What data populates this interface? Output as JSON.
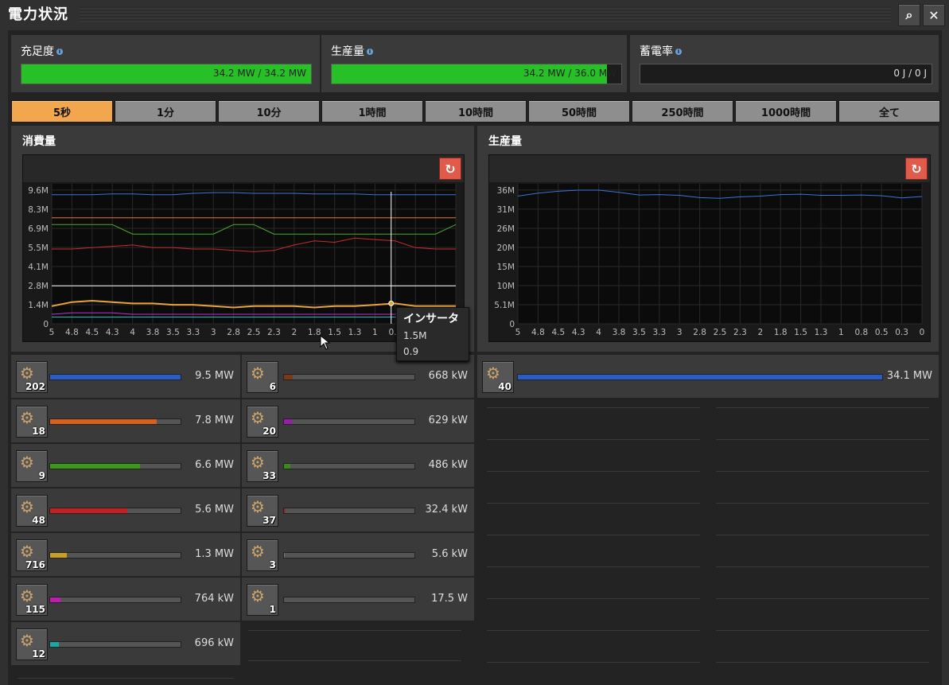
{
  "window": {
    "title": "電力状況"
  },
  "stats": {
    "satisfaction": {
      "label": "充足度",
      "value": "34.2 MW / 34.2 MW",
      "fill": 1.0
    },
    "production": {
      "label": "生産量",
      "value": "34.2 MW / 36.0 MW",
      "fill": 0.95
    },
    "accumulator": {
      "label": "蓄電率",
      "value": "0 J / 0 J",
      "fill": 0
    }
  },
  "tabs": [
    {
      "label": "5秒",
      "active": true
    },
    {
      "label": "1分"
    },
    {
      "label": "10分"
    },
    {
      "label": "1時間"
    },
    {
      "label": "10時間"
    },
    {
      "label": "50時間"
    },
    {
      "label": "250時間"
    },
    {
      "label": "1000時間"
    },
    {
      "label": "全て"
    }
  ],
  "consumption": {
    "label": "消費量",
    "chart_data": {
      "type": "line",
      "title": "消費量",
      "x_ticks": [
        "5",
        "4.8",
        "4.5",
        "4.3",
        "4",
        "3.8",
        "3.5",
        "3.3",
        "3",
        "2.8",
        "2.5",
        "2.3",
        "2",
        "1.8",
        "1.5",
        "1.3",
        "1",
        "0.8",
        "0.5",
        "0.3",
        "0"
      ],
      "y_ticks": [
        "0",
        "1.4M",
        "2.8M",
        "4.1M",
        "5.5M",
        "6.9M",
        "8.3M",
        "9.6M"
      ],
      "ylim": [
        0,
        10300000
      ],
      "series": [
        {
          "color": "#3c73d6",
          "values": [
            9500000,
            9500000,
            9500000,
            9550000,
            9550000,
            9500000,
            9500000,
            9600000,
            9650000,
            9650000,
            9600000,
            9600000,
            9600000,
            9550000,
            9550000,
            9550000,
            9500000,
            9500000,
            9500000,
            9500000,
            9500000
          ]
        },
        {
          "color": "#e67a32",
          "values": [
            7800000,
            7800000,
            7800000,
            7800000,
            7800000,
            7800000,
            7800000,
            7800000,
            7800000,
            7800000,
            7800000,
            7800000,
            7800000,
            7800000,
            7800000,
            7800000,
            7800000,
            7800000,
            7800000,
            7800000,
            7800000
          ]
        },
        {
          "color": "#4aaa2a",
          "values": [
            7300000,
            7300000,
            7300000,
            7300000,
            6600000,
            6600000,
            6600000,
            6600000,
            6600000,
            7300000,
            7300000,
            6600000,
            6600000,
            6600000,
            6600000,
            6600000,
            6600000,
            6600000,
            6600000,
            6600000,
            7300000
          ]
        },
        {
          "color": "#c62d2d",
          "values": [
            5500000,
            5500000,
            5600000,
            5700000,
            5800000,
            5600000,
            5600000,
            5500000,
            5500000,
            5400000,
            5300000,
            5400000,
            5800000,
            6100000,
            6000000,
            6300000,
            6200000,
            6100000,
            5600000,
            5500000,
            5500000
          ]
        },
        {
          "color": "#e8a33a",
          "values": [
            1300000,
            1600000,
            1700000,
            1600000,
            1500000,
            1500000,
            1400000,
            1400000,
            1300000,
            1200000,
            1300000,
            1300000,
            1300000,
            1200000,
            1300000,
            1300000,
            1400000,
            1500000,
            1300000,
            1300000,
            1300000
          ]
        },
        {
          "color": "#c22ed6",
          "values": [
            700000,
            800000,
            800000,
            800000,
            700000,
            700000,
            700000,
            700000,
            700000,
            700000,
            700000,
            700000,
            700000,
            700000,
            700000,
            700000,
            700000,
            700000,
            700000,
            700000,
            700000
          ]
        },
        {
          "color": "#2ab8b8",
          "values": [
            500000,
            500000,
            500000,
            500000,
            500000,
            500000,
            500000,
            500000,
            500000,
            500000,
            500000,
            500000,
            500000,
            500000,
            500000,
            500000,
            500000,
            500000,
            500000,
            500000,
            500000
          ]
        },
        {
          "color": "#ffffff",
          "values": [
            2800000,
            2800000,
            2800000,
            2800000,
            2800000,
            2800000,
            2800000,
            2800000,
            2800000,
            2800000,
            2800000,
            2800000,
            2800000,
            2800000,
            2800000,
            2800000,
            2800000,
            2800000,
            2800000,
            2800000,
            2800000
          ]
        }
      ],
      "cursor_x": "0.9"
    },
    "tooltip": {
      "title": "インサータ",
      "value": "1.5M",
      "time": "0.9"
    }
  },
  "production_chart": {
    "label": "生産量",
    "chart_data": {
      "type": "line",
      "title": "生産量",
      "x_ticks": [
        "5",
        "4.8",
        "4.5",
        "4.3",
        "4",
        "3.8",
        "3.5",
        "3.3",
        "3",
        "2.8",
        "2.5",
        "2.3",
        "2",
        "1.8",
        "1.5",
        "1.3",
        "1",
        "0.8",
        "0.5",
        "0.3",
        "0"
      ],
      "y_ticks": [
        "0",
        "5.1M",
        "10M",
        "15M",
        "20M",
        "26M",
        "31M",
        "36M"
      ],
      "ylim": [
        0,
        37500000
      ],
      "series": [
        {
          "color": "#3c73d6",
          "values": [
            34200000,
            35000000,
            35500000,
            35800000,
            35800000,
            35200000,
            34500000,
            34600000,
            34400000,
            33800000,
            33600000,
            34000000,
            34200000,
            34600000,
            34700000,
            34400000,
            34400000,
            34500000,
            34300000,
            33700000,
            34100000
          ]
        }
      ]
    }
  },
  "consumers_left": [
    {
      "count": "202",
      "value": "9.5 MW",
      "fill": 1.0,
      "color": "#2a5cc8",
      "icon": "radar-icon"
    },
    {
      "count": "18",
      "value": "7.8 MW",
      "fill": 0.82,
      "color": "#d9601a",
      "icon": "assembling-machine-icon"
    },
    {
      "count": "9",
      "value": "6.6 MW",
      "fill": 0.69,
      "color": "#3a9a1a",
      "icon": "pumpjack-icon"
    },
    {
      "count": "48",
      "value": "5.6 MW",
      "fill": 0.59,
      "color": "#c42020",
      "icon": "electric-mining-drill-icon"
    },
    {
      "count": "716",
      "value": "1.3 MW",
      "fill": 0.13,
      "color": "#c8a020",
      "icon": "inserter-icon"
    },
    {
      "count": "115",
      "value": "764 kW",
      "fill": 0.08,
      "color": "#c21ab2",
      "icon": "fast-inserter-icon"
    },
    {
      "count": "12",
      "value": "696 kW",
      "fill": 0.07,
      "color": "#18a8a8",
      "icon": "lab-icon"
    }
  ],
  "consumers_right": [
    {
      "count": "6",
      "value": "668 kW",
      "fill": 0.07,
      "color": "#7a3a1a",
      "icon": "chemical-plant-icon"
    },
    {
      "count": "20",
      "value": "629 kW",
      "fill": 0.06,
      "color": "#9a1ab2",
      "icon": "oil-refinery-icon"
    },
    {
      "count": "33",
      "value": "486 kW",
      "fill": 0.05,
      "color": "#3a8a1a",
      "icon": "pump-icon"
    },
    {
      "count": "37",
      "value": "32.4 kW",
      "fill": 0.01,
      "color": "#9a2a2a",
      "icon": "long-handed-inserter-icon"
    },
    {
      "count": "3",
      "value": "5.6 kW",
      "fill": 0.005,
      "color": "#777777",
      "icon": "centrifuge-icon"
    },
    {
      "count": "1",
      "value": "17.5 W",
      "fill": 0.0,
      "color": "#777777",
      "icon": "roboport-icon"
    }
  ],
  "producers": [
    {
      "count": "40",
      "value": "34.1 MW",
      "fill": 1.0,
      "color": "#2a5cc8",
      "icon": "steam-engine-icon"
    }
  ]
}
